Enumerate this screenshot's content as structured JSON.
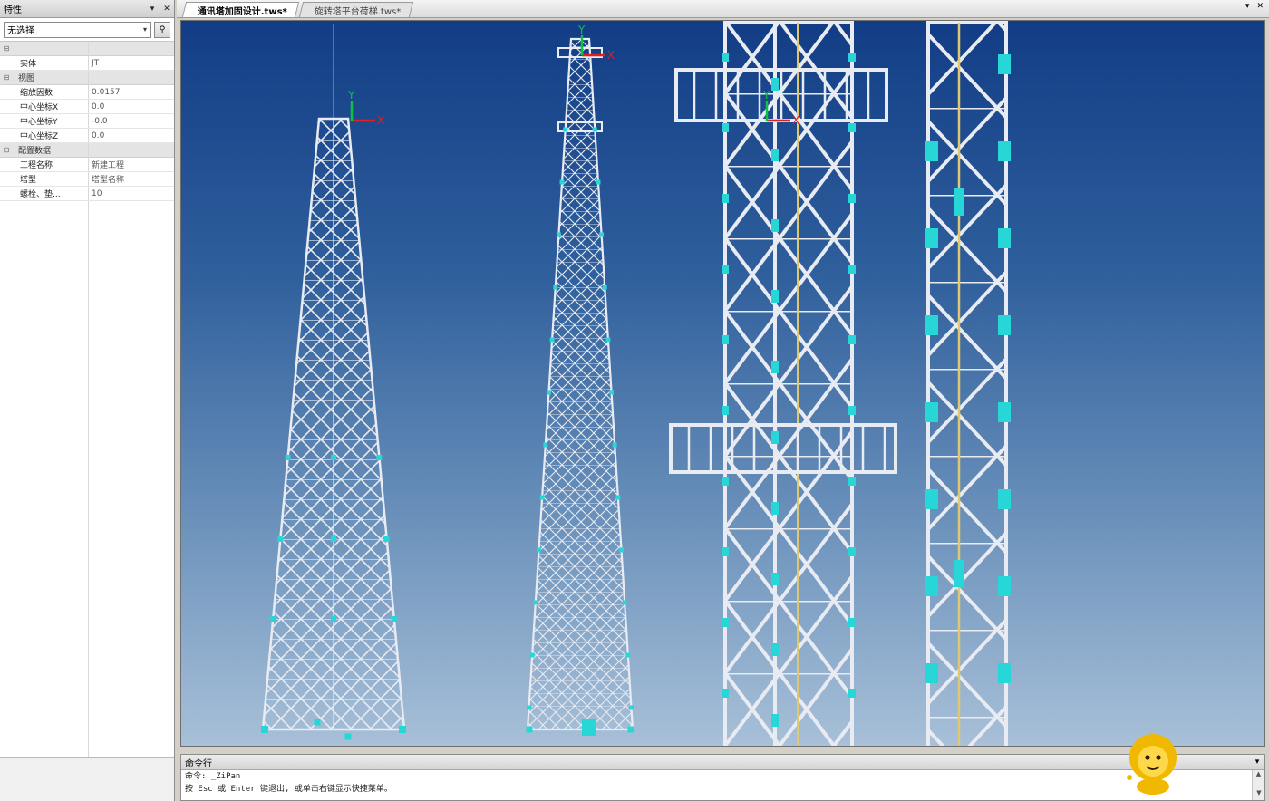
{
  "properties_panel": {
    "title": "特性",
    "selection": "无选择",
    "rows": [
      {
        "type": "cat",
        "label": ""
      },
      {
        "type": "row",
        "key": "实体",
        "value": "JT"
      },
      {
        "type": "cat",
        "label": "视图"
      },
      {
        "type": "row",
        "key": "缩放因数",
        "value": "0.0157"
      },
      {
        "type": "row",
        "key": "中心坐标X",
        "value": "0.0"
      },
      {
        "type": "row",
        "key": "中心坐标Y",
        "value": "-0.0"
      },
      {
        "type": "row",
        "key": "中心坐标Z",
        "value": "0.0"
      },
      {
        "type": "cat",
        "label": "配置数据"
      },
      {
        "type": "row",
        "key": "工程名称",
        "value": "新建工程"
      },
      {
        "type": "row",
        "key": "塔型",
        "value": "塔型名称"
      },
      {
        "type": "row",
        "key": "螺栓、垫...",
        "value": "10"
      }
    ]
  },
  "tabs": [
    {
      "label": "通讯塔加固设计.tws*",
      "active": true
    },
    {
      "label": "旋转塔平台荷梯.tws*",
      "active": false
    }
  ],
  "tab_controls": {
    "menu": "▾",
    "close": "✕"
  },
  "command": {
    "title": "命令行",
    "lines": [
      "命令: _ZiPan",
      "按 Esc 或 Enter 键退出, 或单击右键显示快捷菜单。"
    ]
  },
  "axis_labels": {
    "x": "X",
    "y": "Y"
  },
  "colors": {
    "viewport_top": "#123d86",
    "viewport_bottom": "#a8c0d8",
    "member": "#e8ebf2",
    "joint": "#27d6d6",
    "axis_x": "#e02020",
    "axis_y": "#10c040"
  },
  "icons": {
    "pin": "chevron-down-icon",
    "close": "close-icon",
    "quick_select": "quick-select-icon",
    "collapse": "collapse-toggle-icon"
  }
}
